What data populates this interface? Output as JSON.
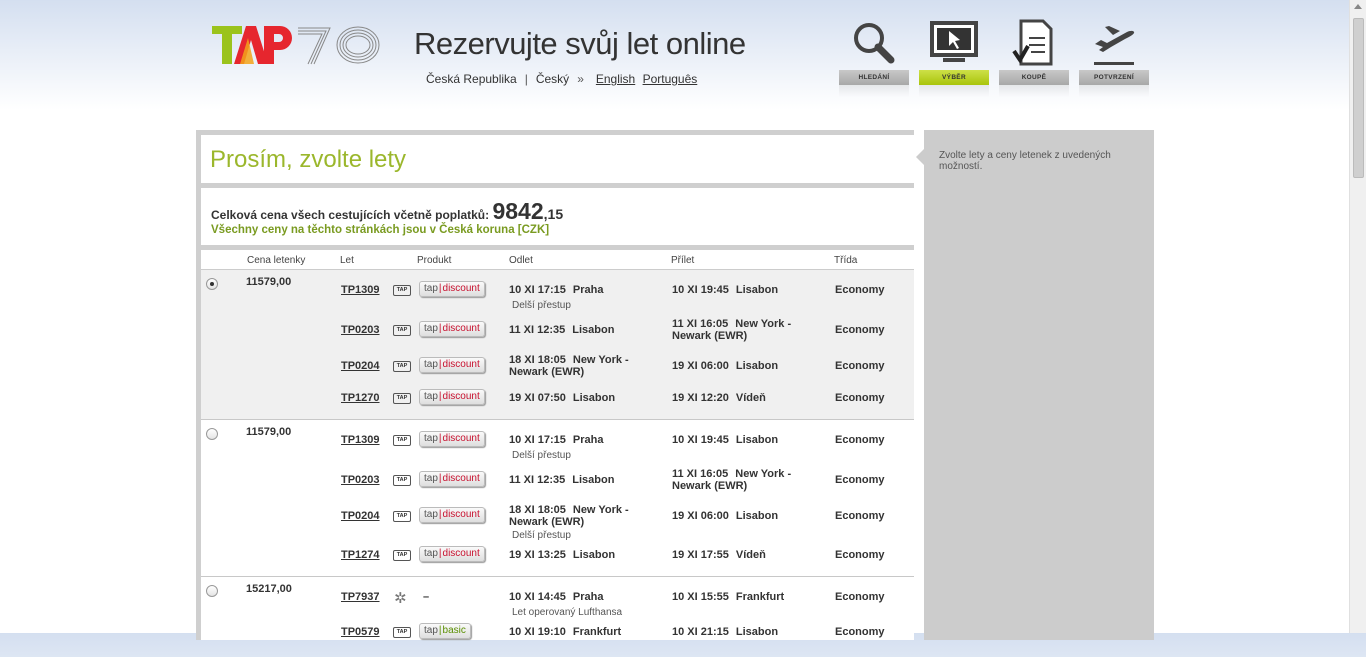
{
  "header": {
    "headline": "Rezervujte svůj let online",
    "country": "Česká Republika",
    "separator": "|",
    "language": "Český",
    "arrow": "»",
    "lang_links": [
      "English",
      "Português"
    ],
    "logo_icon": "tap-70-logo"
  },
  "steps": [
    {
      "label": "HLEDÁNÍ",
      "icon": "search-icon",
      "active": false
    },
    {
      "label": "VÝBĚR",
      "icon": "screen-cursor-icon",
      "active": true
    },
    {
      "label": "KOUPĚ",
      "icon": "document-check-icon",
      "active": false
    },
    {
      "label": "POTVRZENÍ",
      "icon": "plane-icon",
      "active": false
    }
  ],
  "colors": {
    "accent_green": "#9bb72c",
    "active_step": "#b5cc1b",
    "discount_red": "#c8102e",
    "sidebar_gray": "#cccccc"
  },
  "page": {
    "title": "Prosím, zvolte lety",
    "total_label": "Celková cena všech cestujících včetně poplatků:",
    "total_main": "9842",
    "total_cents": ",15",
    "currency_note": "Všechny ceny na těchto stránkách jsou v Česká koruna [CZK]"
  },
  "table": {
    "headers": [
      "Cena letenky",
      "Let",
      "Produkt",
      "Odlet",
      "Přílet",
      "Třída"
    ]
  },
  "options": [
    {
      "price": "11579,00",
      "selected": true,
      "segments": [
        {
          "flight": "TP1309",
          "carrier": "TAP",
          "prod_a": "tap",
          "prod_b": "discount",
          "dep_time": "10 XI 17:15",
          "dep_city": "Praha",
          "arr_time": "10 XI 19:45",
          "arr_city": "Lisabon",
          "class": "Economy",
          "note": "Delší přestup"
        },
        {
          "flight": "TP0203",
          "carrier": "TAP",
          "prod_a": "tap",
          "prod_b": "discount",
          "dep_time": "11 XI 12:35",
          "dep_city": "Lisabon",
          "arr_time": "11 XI 16:05",
          "arr_city": "New York - Newark (EWR)",
          "class": "Economy"
        },
        {
          "flight": "TP0204",
          "carrier": "TAP",
          "prod_a": "tap",
          "prod_b": "discount",
          "dep_time": "18 XI 18:05",
          "dep_city": "New York - Newark (EWR)",
          "arr_time": "19 XI 06:00",
          "arr_city": "Lisabon",
          "class": "Economy"
        },
        {
          "flight": "TP1270",
          "carrier": "TAP",
          "prod_a": "tap",
          "prod_b": "discount",
          "dep_time": "19 XI 07:50",
          "dep_city": "Lisabon",
          "arr_time": "19 XI 12:20",
          "arr_city": "Vídeň",
          "class": "Economy"
        }
      ]
    },
    {
      "price": "11579,00",
      "selected": false,
      "segments": [
        {
          "flight": "TP1309",
          "carrier": "TAP",
          "prod_a": "tap",
          "prod_b": "discount",
          "dep_time": "10 XI 17:15",
          "dep_city": "Praha",
          "arr_time": "10 XI 19:45",
          "arr_city": "Lisabon",
          "class": "Economy",
          "note": "Delší přestup"
        },
        {
          "flight": "TP0203",
          "carrier": "TAP",
          "prod_a": "tap",
          "prod_b": "discount",
          "dep_time": "11 XI 12:35",
          "dep_city": "Lisabon",
          "arr_time": "11 XI 16:05",
          "arr_city": "New York - Newark (EWR)",
          "class": "Economy"
        },
        {
          "flight": "TP0204",
          "carrier": "TAP",
          "prod_a": "tap",
          "prod_b": "discount",
          "dep_time": "18 XI 18:05",
          "dep_city": "New York - Newark (EWR)",
          "arr_time": "19 XI 06:00",
          "arr_city": "Lisabon",
          "class": "Economy",
          "note": "Delší přestup"
        },
        {
          "flight": "TP1274",
          "carrier": "TAP",
          "prod_a": "tap",
          "prod_b": "discount",
          "dep_time": "19 XI 13:25",
          "dep_city": "Lisabon",
          "arr_time": "19 XI 17:55",
          "arr_city": "Vídeň",
          "class": "Economy"
        }
      ]
    },
    {
      "price": "15217,00",
      "selected": false,
      "segments": [
        {
          "flight": "TP7937",
          "carrier": "star-alliance-icon",
          "prod_dash": "–",
          "dep_time": "10 XI 14:45",
          "dep_city": "Praha",
          "arr_time": "10 XI 15:55",
          "arr_city": "Frankfurt",
          "class": "Economy",
          "note": "Let operovaný Lufthansa"
        },
        {
          "flight": "TP0579",
          "carrier": "TAP",
          "prod_a": "tap",
          "prod_b": "basic",
          "dep_time": "10 XI 19:10",
          "dep_city": "Frankfurt",
          "arr_time": "10 XI 21:15",
          "arr_city": "Lisabon",
          "class": "Economy"
        }
      ]
    }
  ],
  "sidebar": {
    "text": "Zvolte lety a ceny letenek z uvedených možností."
  }
}
